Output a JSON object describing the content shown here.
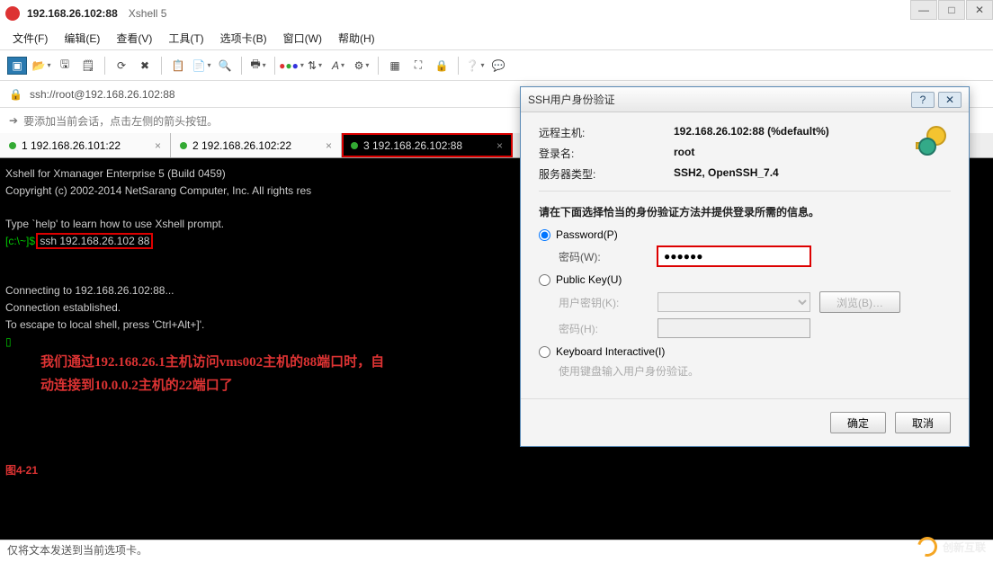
{
  "window": {
    "title": "192.168.26.102:88",
    "subtitle": "Xshell 5"
  },
  "menus": [
    "文件(F)",
    "编辑(E)",
    "查看(V)",
    "工具(T)",
    "选项卡(B)",
    "窗口(W)",
    "帮助(H)"
  ],
  "address": "ssh://root@192.168.26.102:88",
  "hint": "要添加当前会话，点击左侧的箭头按钮。",
  "tabs": [
    {
      "label": "1 192.168.26.101:22",
      "active": false
    },
    {
      "label": "2 192.168.26.102:22",
      "active": false
    },
    {
      "label": "3 192.168.26.102:88",
      "active": true
    }
  ],
  "terminal": {
    "line1": "Xshell for Xmanager Enterprise 5 (Build 0459)",
    "line2": "Copyright (c) 2002-2014 NetSarang Computer, Inc. All rights res",
    "line3": "Type `help' to learn how to use Xshell prompt.",
    "prompt": "[c:\\~]$ ",
    "cmd": "ssh 192.168.26.102 88",
    "conn1": "Connecting to 192.168.26.102:88...",
    "conn2": "Connection established.",
    "conn3": "To escape to local shell, press 'Ctrl+Alt+]'.",
    "note1": "我们通过192.168.26.1主机访问vms002主机的88端口时，自",
    "note2": "动连接到10.0.0.2主机的22端口了",
    "fig": "图4-21"
  },
  "status": "仅将文本发送到当前选项卡。",
  "dialog": {
    "title": "SSH用户身份验证",
    "remoteHostLabel": "远程主机:",
    "remoteHost": "192.168.26.102:88 (%default%)",
    "loginLabel": "登录名:",
    "login": "root",
    "serverTypeLabel": "服务器类型:",
    "serverType": "SSH2, OpenSSH_7.4",
    "instruction": "请在下面选择恰当的身份验证方法并提供登录所需的信息。",
    "optPassword": "Password(P)",
    "pwdLabel": "密码(W):",
    "pwdValue": "●●●●●●",
    "optPublicKey": "Public Key(U)",
    "userKeyLabel": "用户密钥(K):",
    "browse": "浏览(B)…",
    "pkPwdLabel": "密码(H):",
    "optKeyboard": "Keyboard Interactive(I)",
    "kbHint": "使用键盘输入用户身份验证。",
    "ok": "确定",
    "cancel": "取消"
  },
  "watermark": "创新互联"
}
